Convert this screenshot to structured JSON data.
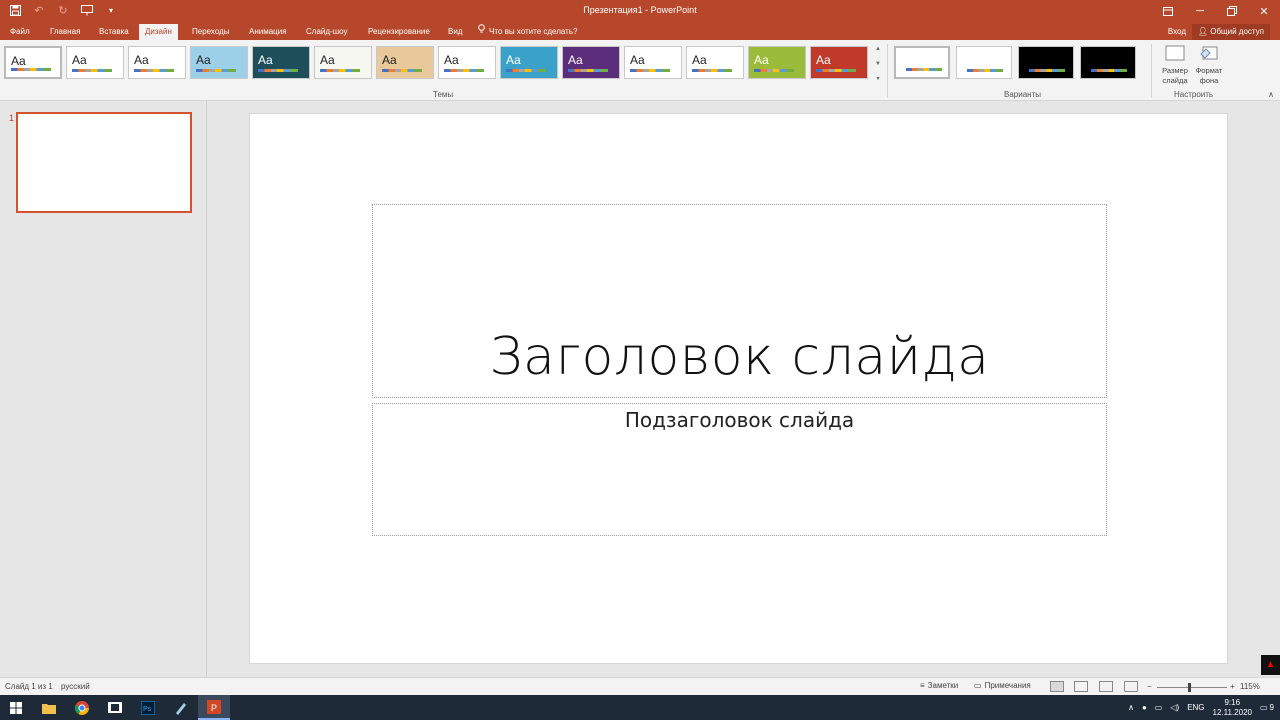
{
  "window": {
    "title": "Презентация1 - PowerPoint",
    "controls": [
      "restore-ribbon",
      "minimize",
      "maximize",
      "close"
    ]
  },
  "quick_access": [
    "save-icon",
    "undo-icon",
    "redo-icon",
    "start-slideshow-icon",
    "customize-icon"
  ],
  "tabs": [
    {
      "label": "Файл"
    },
    {
      "label": "Главная"
    },
    {
      "label": "Вставка"
    },
    {
      "label": "Дизайн",
      "active": true
    },
    {
      "label": "Переходы"
    },
    {
      "label": "Анимация"
    },
    {
      "label": "Слайд-шоу"
    },
    {
      "label": "Рецензирование"
    },
    {
      "label": "Вид"
    }
  ],
  "tell_me": "Что вы хотите сделать?",
  "sign_in": "Вход",
  "share": "Общий доступ",
  "ribbon": {
    "themes_label": "Темы",
    "variants_label": "Варианты",
    "customize_label": "Настроить",
    "theme_sample": "Aa",
    "slide_size": "Размер слайда",
    "slide_size_line1": "Размер",
    "slide_size_line2": "слайда",
    "format_background": "Формат фона",
    "format_bg_line1": "Формат",
    "format_bg_line2": "фона",
    "theme_colors": [
      "#ffffff",
      "#ffffff",
      "#ffffff",
      "#9ccfe8",
      "#1f4e5b",
      "#f7f7f2",
      "#e9c99a",
      "#ffffff",
      "#3aa2c9",
      "#5b2d7a",
      "#ffffff",
      "#ffffff",
      "#9bbb3b",
      "#c0392b"
    ],
    "variant_colors": [
      "#ffffff",
      "#ffffff",
      "#000000",
      "#000000"
    ]
  },
  "slides_pane": {
    "slide_number": "1"
  },
  "slide": {
    "title": "Заголовок слайда",
    "subtitle": "Подзаголовок слайда"
  },
  "status": {
    "slide_info": "Слайд 1 из 1",
    "language": "русский",
    "notes": "Заметки",
    "comments": "Примечания",
    "zoom": "115%"
  },
  "taskbar": {
    "apps": [
      "windows-start-icon",
      "file-explorer-icon",
      "chrome-icon",
      "film-app-icon",
      "photoshop-icon",
      "paint-app-icon",
      "powerpoint-icon"
    ],
    "lang": "ENG",
    "time": "9:16",
    "date": "12.11.2020",
    "notifications": "9"
  }
}
